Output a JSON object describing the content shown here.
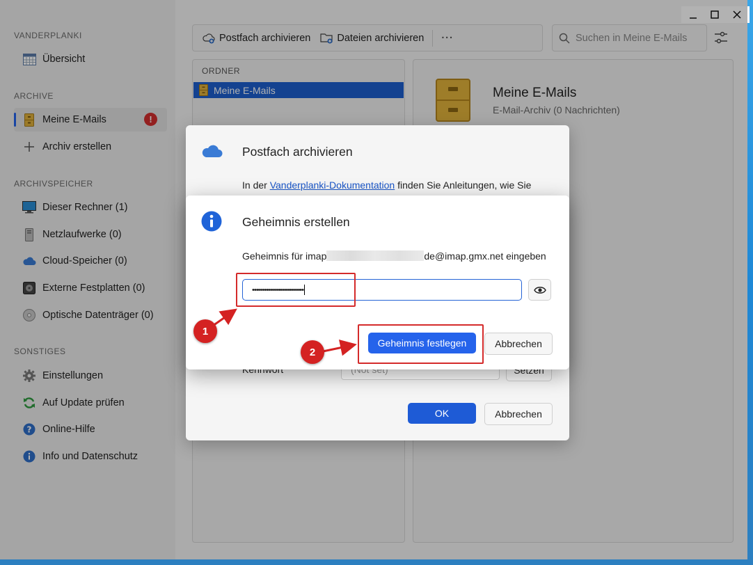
{
  "window": {
    "controls": {
      "minimize": "─",
      "maximize": "☐",
      "close": "✕"
    }
  },
  "sidebar": {
    "sections": [
      {
        "title": "VANDERPLANKI",
        "items": [
          {
            "label": "Übersicht",
            "icon": "calendar-grid-icon"
          }
        ]
      },
      {
        "title": "ARCHIVE",
        "items": [
          {
            "label": "Meine E-Mails",
            "icon": "file-cabinet-icon",
            "active": true,
            "badge": "!"
          },
          {
            "label": "Archiv erstellen",
            "icon": "plus-icon"
          }
        ]
      },
      {
        "title": "ARCHIVSPEICHER",
        "items": [
          {
            "label": "Dieser Rechner (1)",
            "icon": "monitor-icon"
          },
          {
            "label": "Netzlaufwerke (0)",
            "icon": "server-tower-icon"
          },
          {
            "label": "Cloud-Speicher (0)",
            "icon": "cloud-icon"
          },
          {
            "label": "Externe Festplatten (0)",
            "icon": "hard-disk-icon"
          },
          {
            "label": "Optische Datenträger (0)",
            "icon": "optical-disc-icon"
          }
        ]
      },
      {
        "title": "SONSTIGES",
        "items": [
          {
            "label": "Einstellungen",
            "icon": "gear-icon"
          },
          {
            "label": "Auf Update prüfen",
            "icon": "refresh-icon"
          },
          {
            "label": "Online-Hilfe",
            "icon": "help-icon"
          },
          {
            "label": "Info und Datenschutz",
            "icon": "info-icon"
          }
        ]
      }
    ]
  },
  "toolbar": {
    "archive_mailbox_label": "Postfach archivieren",
    "archive_files_label": "Dateien archivieren",
    "more_label": "···",
    "search_placeholder": "Suchen in Meine E-Mails"
  },
  "folders": {
    "header": "ORDNER",
    "items": [
      {
        "label": "Meine E-Mails",
        "selected": true
      }
    ]
  },
  "details": {
    "title": "Meine E-Mails",
    "subtitle": "E-Mail-Archiv (0 Nachrichten)"
  },
  "outer_dialog": {
    "title": "Postfach archivieren",
    "intro_prefix": "In der ",
    "intro_link": "Vanderplanki-Dokumentation",
    "intro_suffix": " finden Sie Anleitungen, wie Sie",
    "password_label": "Kennwort",
    "password_placeholder": "(Not set)",
    "set_button": "Setzen",
    "ok_button": "OK",
    "cancel_button": "Abbrechen"
  },
  "inner_dialog": {
    "title": "Geheimnis erstellen",
    "prompt_prefix": "Geheimnis für imap",
    "prompt_suffix": "de@imap.gmx.net eingeben",
    "secret_value": "••••••••••••••••••••••••••",
    "confirm_button": "Geheimnis festlegen",
    "cancel_button": "Abbrechen"
  },
  "annotations": [
    {
      "label": "1"
    },
    {
      "label": "2"
    }
  ],
  "colors": {
    "accent": "#1e5bd6",
    "marker": "#d42222",
    "badge": "#d32f2f"
  }
}
